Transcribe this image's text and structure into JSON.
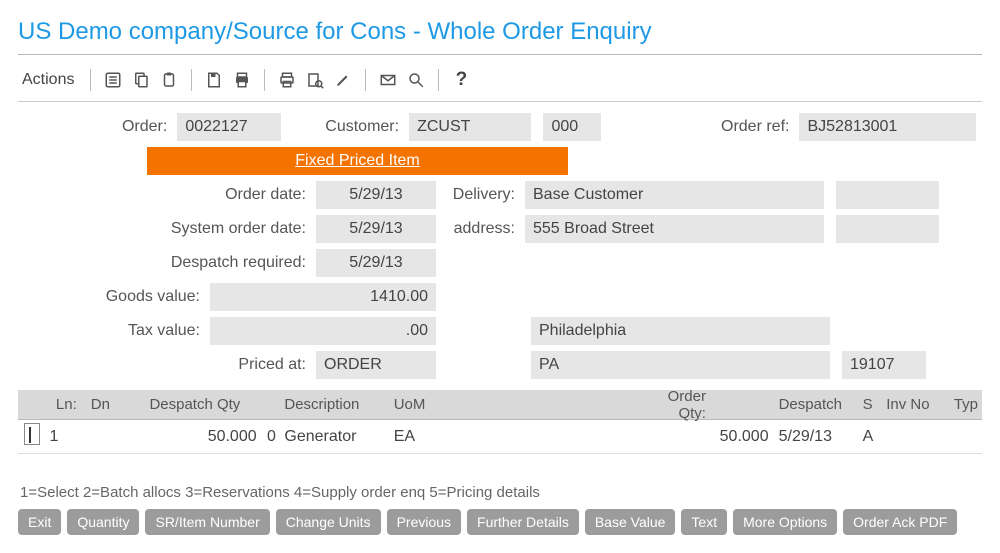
{
  "title": "US Demo company/Source for Cons - Whole Order Enquiry",
  "toolbar": {
    "label": "Actions"
  },
  "header": {
    "order_label": "Order:",
    "order_value": "0022127",
    "customer_label": "Customer:",
    "customer_value": "ZCUST",
    "customer_value2": "000",
    "order_ref_label": "Order ref:",
    "order_ref_value": "BJ52813001",
    "banner": "Fixed Priced Item",
    "order_date_label": "Order date:",
    "order_date_value": "5/29/13",
    "system_order_date_label": "System order date:",
    "system_order_date_value": "5/29/13",
    "despatch_required_label": "Despatch required:",
    "despatch_required_value": "5/29/13",
    "delivery_label": "Delivery:",
    "address_label": "address:",
    "delivery_name": "Base Customer",
    "delivery_street": "555 Broad Street",
    "delivery_city": "Philadelphia",
    "delivery_state": "PA",
    "delivery_zip": "19107",
    "goods_value_label": "Goods value:",
    "goods_value": "1410.00",
    "tax_value_label": "Tax value:",
    "tax_value": ".00",
    "priced_at_label": "Priced at:",
    "priced_at_value": "ORDER"
  },
  "table": {
    "cols": {
      "ln": "Ln:",
      "dn": "Dn",
      "dqty": "Despatch Qty",
      "desc": "Description",
      "uom": "UoM",
      "oqty": "Order Qty:",
      "desp": "Despatch",
      "s": "S",
      "inv": "Inv No",
      "typ": "Typ"
    },
    "rows": [
      {
        "ln": "1",
        "dn": "",
        "dqty": "50.000",
        "zero": "0",
        "desc": "Generator",
        "uom": "EA",
        "oqty": "50.000",
        "desp": "5/29/13",
        "s": "A",
        "inv": "",
        "typ": ""
      }
    ]
  },
  "help_line": "1=Select  2=Batch allocs  3=Reservations  4=Supply order enq  5=Pricing details",
  "buttons": [
    "Exit",
    "Quantity",
    "SR/Item Number",
    "Change Units",
    "Previous",
    "Further Details",
    "Base Value",
    "Text",
    "More Options",
    "Order Ack PDF"
  ]
}
